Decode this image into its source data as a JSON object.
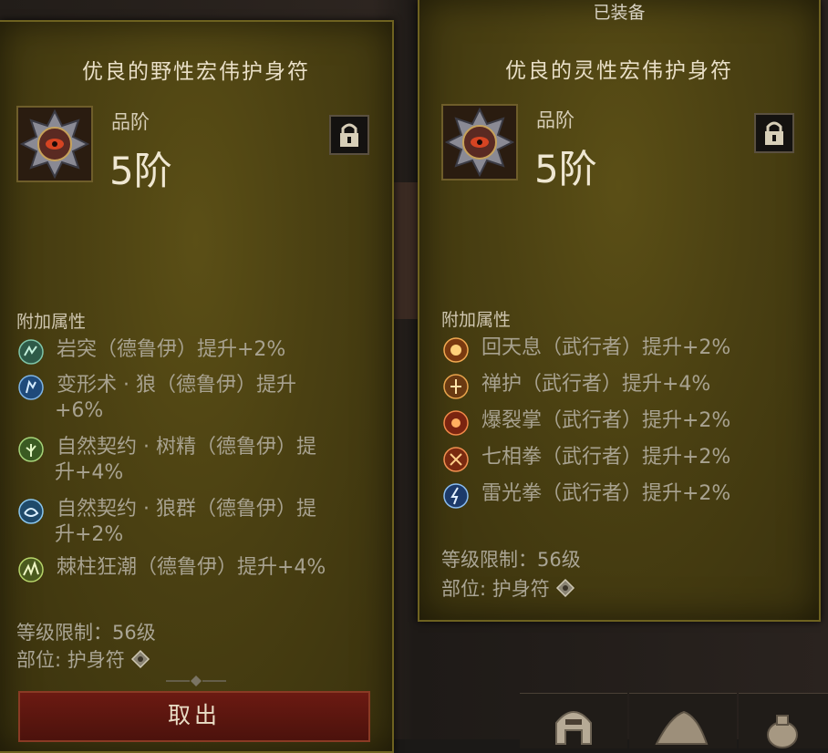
{
  "left_tooltip": {
    "title": "优良的野性宏伟护身符",
    "grade_label": "品阶",
    "grade_value": "5阶",
    "section_header": "附加属性",
    "affixes": [
      {
        "icon": "rock-spike-icon",
        "text": "岩突（德鲁伊）提升+2%"
      },
      {
        "icon": "werewolf-shapeshift-icon",
        "text": "变形术 · 狼（德鲁伊）提升"
      },
      {
        "icon": "werewolf-shapeshift-icon-cont",
        "text": "+6%"
      },
      {
        "icon": "treant-pact-icon",
        "text": "自然契约 · 树精（德鲁伊）提"
      },
      {
        "icon": "treant-pact-icon-cont",
        "text": "升+4%"
      },
      {
        "icon": "wolf-pack-pact-icon",
        "text": "自然契约 · 狼群（德鲁伊）提"
      },
      {
        "icon": "wolf-pack-pact-icon-cont",
        "text": "升+2%"
      },
      {
        "icon": "thorn-tide-icon",
        "text": "棘柱狂潮（德鲁伊）提升+4%"
      }
    ],
    "level_requirement": "等级限制：56级",
    "slot": "部位: 护身符",
    "takeout_button": "取出"
  },
  "right_tooltip": {
    "equipped_label": "已装备",
    "title": "优良的灵性宏伟护身符",
    "grade_label": "品阶",
    "grade_value": "5阶",
    "section_header": "附加属性",
    "affixes": [
      {
        "icon": "revival-breath-icon",
        "text": "回天息（武行者）提升+2%"
      },
      {
        "icon": "zen-guard-icon",
        "text": "禅护（武行者）提升+4%"
      },
      {
        "icon": "burst-palm-icon",
        "text": "爆裂掌（武行者）提升+2%"
      },
      {
        "icon": "seven-fist-icon",
        "text": "七相拳（武行者）提升+2%"
      },
      {
        "icon": "thunder-fist-icon",
        "text": "雷光拳（武行者）提升+2%"
      }
    ],
    "level_requirement": "等级限制：56级",
    "slot": "部位: 护身符"
  },
  "icons": {
    "amulet": "amulet-icon",
    "lock": "lock-icon",
    "slot_marker": "diamond-slot-icon",
    "helmet_tab": "helmet-icon",
    "scroll_tab": "scroll-icon",
    "bag_tab": "bag-icon"
  },
  "colors": {
    "panel_bg": "#4a4012",
    "button_red": "#6b1a12",
    "title_text": "#e9dfc7",
    "affix_text": "#a8a290"
  }
}
